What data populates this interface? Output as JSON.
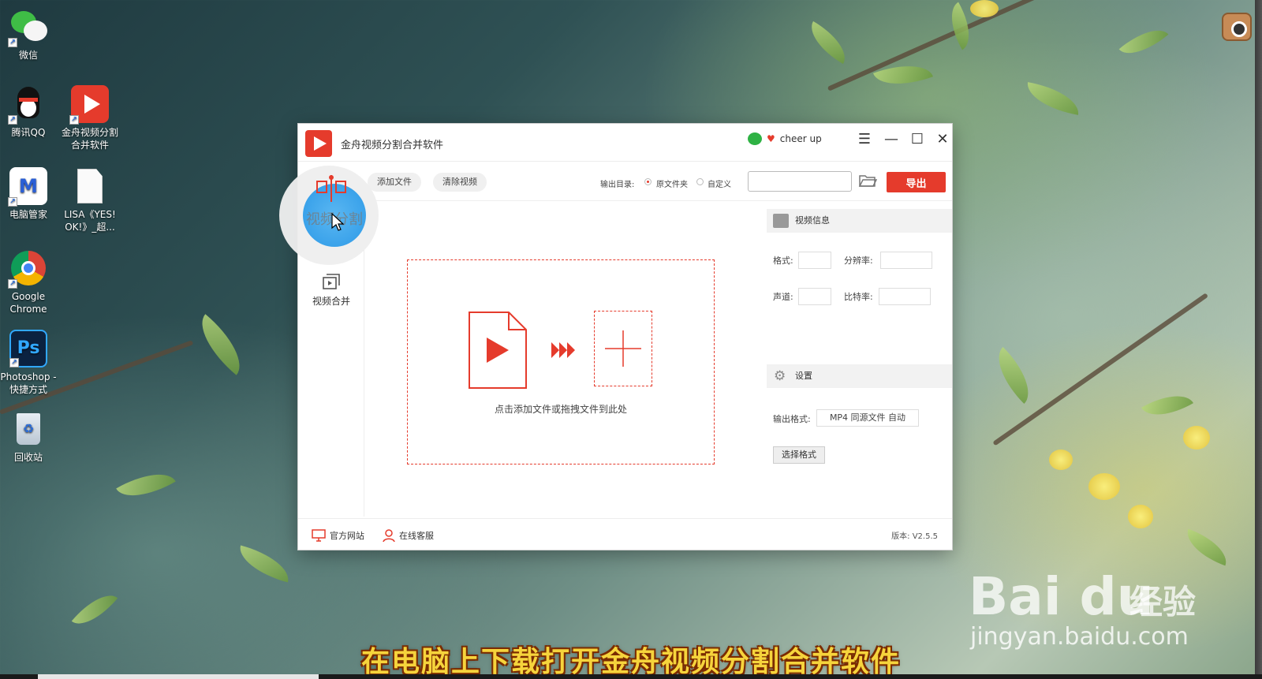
{
  "desktop": {
    "icons": [
      {
        "label": "微信",
        "icon": "wechat-icon"
      },
      {
        "label": "腾讯QQ",
        "icon": "qq-icon"
      },
      {
        "label": "金舟视频分割合并软件",
        "icon": "video-split-app-icon"
      },
      {
        "label": "电脑管家",
        "icon": "pc-manager-icon"
      },
      {
        "label": "LISA《YES! OK!》_超...",
        "icon": "document-icon"
      },
      {
        "label": "Google Chrome",
        "icon": "chrome-icon"
      },
      {
        "label": "Photoshop - 快捷方式",
        "icon": "photoshop-icon"
      },
      {
        "label": "回收站",
        "icon": "recycle-bin-icon"
      }
    ]
  },
  "window": {
    "title": "金舟视频分割合并软件",
    "user_name": "cheer up"
  },
  "toolbar": {
    "add_file": "添加文件",
    "clear_video": "清除视频",
    "output_dir_label": "输出目录:",
    "option_source": "原文件夹",
    "option_custom": "自定义",
    "path_value": "",
    "export": "导出"
  },
  "sidebar": {
    "split": "视频分割",
    "merge": "视频合并"
  },
  "drop_zone": {
    "hint": "点击添加文件或拖拽文件到此处"
  },
  "video_info": {
    "header": "视频信息",
    "format_label": "格式:",
    "resolution_label": "分辨率:",
    "channel_label": "声道:",
    "bitrate_label": "比特率:",
    "format_value": "",
    "resolution_value": "",
    "channel_value": "",
    "bitrate_value": ""
  },
  "settings": {
    "header": "设置",
    "output_format_label": "输出格式:",
    "output_format_value": "MP4 同源文件 自动",
    "choose_format": "选择格式"
  },
  "footer": {
    "website": "官方网站",
    "support": "在线客服",
    "version": "版本: V2.5.5"
  },
  "overlay": {
    "subtitle": "在电脑上下载打开金舟视频分割合并软件",
    "watermark_logo": "Bai du",
    "watermark_cn": "经验",
    "watermark_url": "jingyan.baidu.com"
  },
  "colors": {
    "accent": "#e53b2c",
    "click_highlight": "#3aa2ea",
    "subtitle": "#f6d43c"
  }
}
